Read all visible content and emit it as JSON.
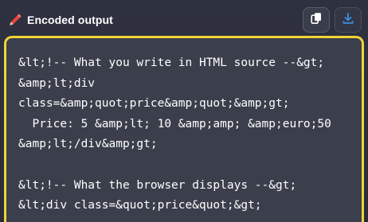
{
  "header": {
    "title": "Encoded output",
    "icon": "pencil-icon",
    "buttons": [
      {
        "icon": "copy-icon"
      },
      {
        "icon": "download-icon"
      }
    ]
  },
  "output": {
    "lines": [
      "&lt;!-- What you write in HTML source --&gt;",
      "&amp;lt;div",
      "class=&amp;quot;price&amp;quot;&amp;gt;",
      "  Price: 5 &amp;lt; 10 &amp;amp; &amp;euro;50",
      "&amp;lt;/div&amp;gt;",
      "",
      "&lt;!-- What the browser displays --&gt;",
      "&lt;div class=&quot;price&quot;&gt;"
    ],
    "border_color": "#f2d23a"
  },
  "colors": {
    "accent_red": "#e8453c",
    "download_blue": "#3d8fe0",
    "background": "#2b2e3a"
  }
}
